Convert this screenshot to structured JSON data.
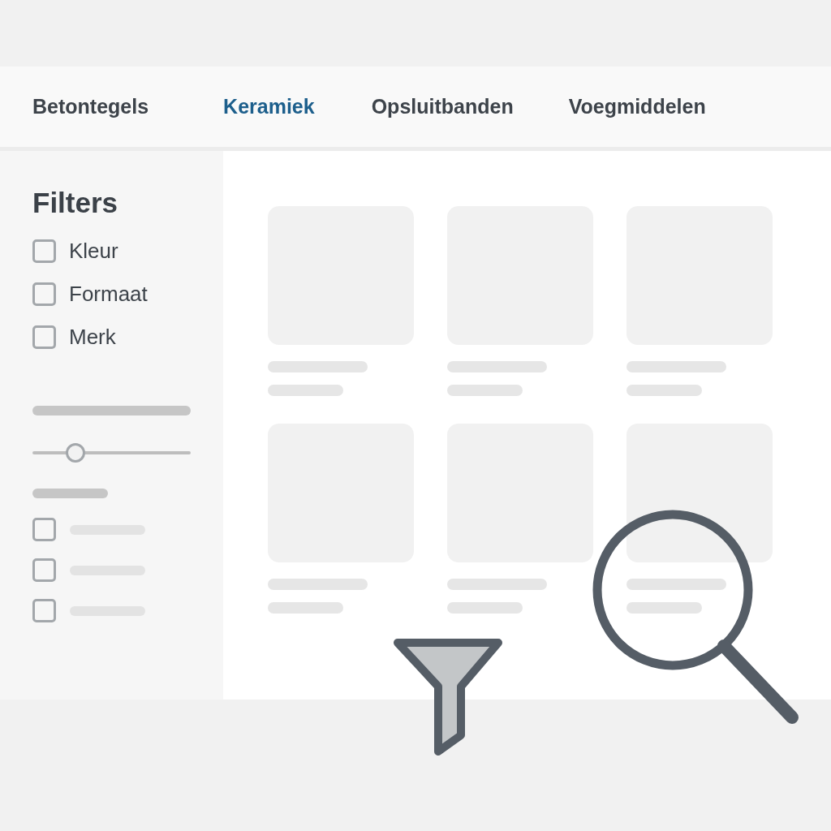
{
  "tabs": [
    {
      "label": "Betontegels",
      "selected": false
    },
    {
      "label": "Keramiek",
      "selected": true
    },
    {
      "label": "Opsluitbanden",
      "selected": false
    },
    {
      "label": "Voegmiddelen",
      "selected": false
    }
  ],
  "filters": {
    "title": "Filters",
    "options": [
      {
        "label": "Kleur",
        "checked": false
      },
      {
        "label": "Formaat",
        "checked": false
      },
      {
        "label": "Merk",
        "checked": false
      }
    ],
    "slider": {
      "level": 0.27
    },
    "placeholder_options": [
      {
        "checked": false
      },
      {
        "checked": false
      },
      {
        "checked": false
      }
    ]
  },
  "product_cards": [
    {
      "kind": "placeholder"
    },
    {
      "kind": "placeholder"
    },
    {
      "kind": "placeholder"
    },
    {
      "kind": "placeholder"
    },
    {
      "kind": "placeholder"
    },
    {
      "kind": "placeholder"
    }
  ]
}
